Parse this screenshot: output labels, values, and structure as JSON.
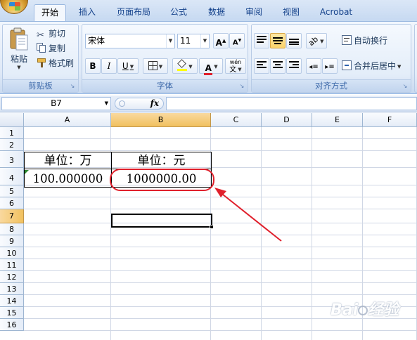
{
  "tabs": [
    {
      "label": "开始",
      "active": true
    },
    {
      "label": "插入"
    },
    {
      "label": "页面布局"
    },
    {
      "label": "公式"
    },
    {
      "label": "数据"
    },
    {
      "label": "审阅"
    },
    {
      "label": "视图"
    },
    {
      "label": "Acrobat"
    }
  ],
  "clipboard": {
    "paste": "粘贴",
    "cut": "剪切",
    "copy": "复制",
    "format_painter": "格式刷",
    "label": "剪贴板"
  },
  "font": {
    "name": "宋体",
    "size": "11",
    "grow": "A",
    "shrink": "A",
    "bold": "B",
    "italic": "I",
    "underline": "U",
    "font_color_letter": "A",
    "phonetic": "wén",
    "label": "字体"
  },
  "alignment": {
    "wrap_text": "自动换行",
    "merge_center": "合并后居中",
    "label": "对齐方式"
  },
  "formula_bar": {
    "name_box": "B7",
    "fx": "fx",
    "formula": ""
  },
  "sheet": {
    "columns": [
      "A",
      "B",
      "C",
      "D",
      "E",
      "F"
    ],
    "rows": [
      "1",
      "2",
      "3",
      "4",
      "5",
      "6",
      "7",
      "8",
      "9",
      "10",
      "11",
      "12",
      "13",
      "14",
      "15",
      "16"
    ],
    "selected_cell": "B7",
    "cells": {
      "A3": "单位：万",
      "B3": "单位：元",
      "A4": "100.000000",
      "B4": "1000000.00"
    }
  },
  "colors": {
    "annotation_red": "#e0202c",
    "selection_orange": "#f1c15f",
    "ribbon_blue": "#dfe9f7"
  }
}
